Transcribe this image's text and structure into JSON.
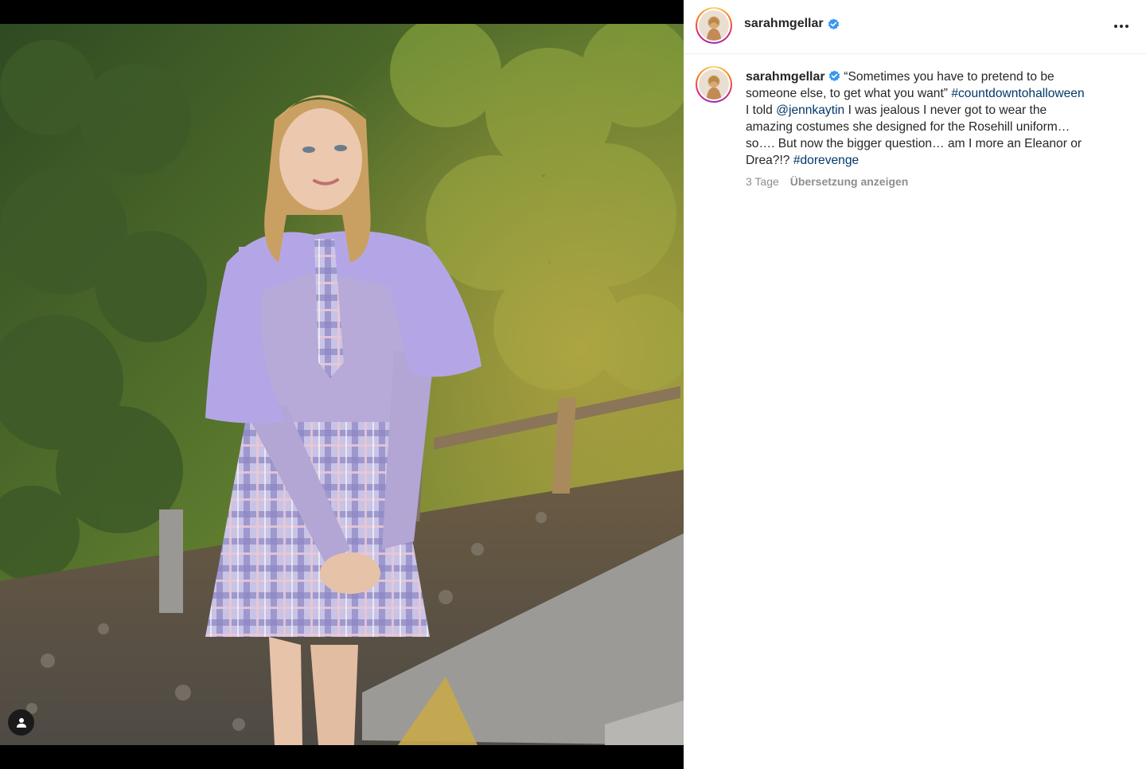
{
  "post": {
    "username": "sarahmgellar",
    "verified": true,
    "more_icon": "more-horizontal-icon",
    "tag_icon": "user-tag-icon",
    "caption": {
      "part1": "“Sometimes you have to pretend to be",
      "part2": "someone else, to get what you want”",
      "hashtag1": "#countdowntohalloween",
      "part3_pre": "I told",
      "mention": "@jennkaytin",
      "part3_post": "I was jealous I never got to wear the",
      "part4": "amazing costumes she designed for the Rosehill uniform…",
      "part5": "so…. But now the bigger question… am I more an Eleanor or",
      "part6": "Drea?!?",
      "hashtag2": "#dorevenge"
    },
    "timestamp": "3 Tage",
    "translate_label": "Übersetzung anzeigen"
  },
  "colors": {
    "link": "#00376b",
    "verified": "#3897f0",
    "text": "#262626",
    "secondary": "#8e8e8e"
  }
}
